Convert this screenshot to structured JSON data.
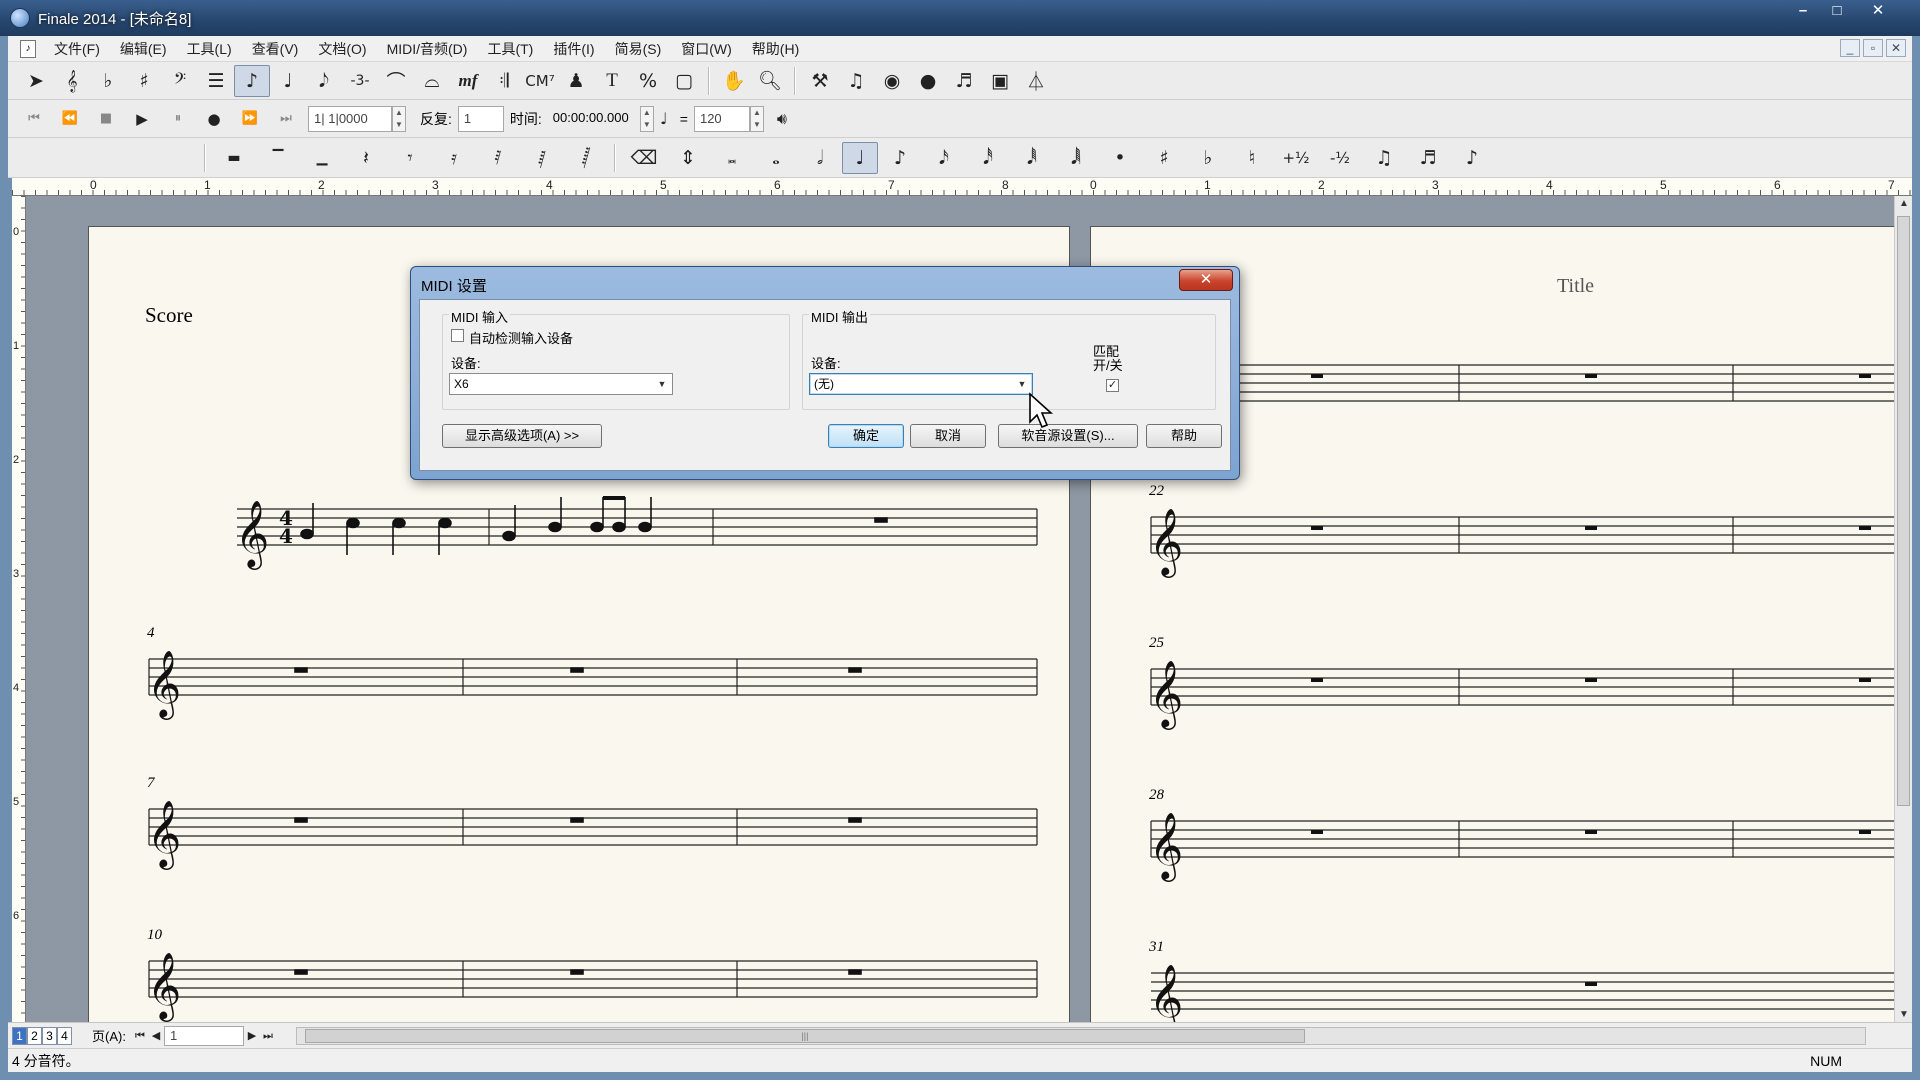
{
  "window": {
    "title": "Finale 2014 - [未命名8]",
    "controls": [
      "–",
      "□",
      "✕"
    ]
  },
  "menubar": {
    "items": [
      "文件(F)",
      "编辑(E)",
      "工具(L)",
      "查看(V)",
      "文档(O)",
      "MIDI/音频(D)",
      "工具(T)",
      "插件(I)",
      "简易(S)",
      "窗口(W)",
      "帮助(H)"
    ]
  },
  "toolbar_main": {
    "chord_symbol": "CM⁷",
    "text_tool": "T",
    "percent_tool": "%",
    "expression_tool": "mf"
  },
  "playback": {
    "position": "1| 1|0000",
    "repeat_label": "反复:",
    "repeat_value": "1",
    "time_label": "时间:",
    "time_value": "00:00:00.000",
    "equals": "=",
    "tempo": "120"
  },
  "simple_entry": {
    "plus_half": "+½",
    "minus_half": "-½"
  },
  "ruler": {
    "top_numbers": [
      "0",
      "1",
      "2",
      "3",
      "4",
      "5",
      "6",
      "7",
      "8",
      "0",
      "1",
      "2",
      "3",
      "4",
      "5",
      "6",
      "7"
    ],
    "left_numbers": [
      "0",
      "1",
      "2",
      "3",
      "4",
      "5",
      "6"
    ]
  },
  "score": {
    "left_page_label": "Score",
    "right_page_title": "Title",
    "measure_numbers_left": [
      "4",
      "7",
      "10"
    ],
    "measure_numbers_right": [
      "22",
      "25",
      "28",
      "31"
    ]
  },
  "dialog": {
    "title": "MIDI 设置",
    "close": "✕",
    "input_group": "MIDI 输入",
    "auto_detect_label": "自动检测输入设备",
    "auto_detect_checked": false,
    "input_device_label": "设备:",
    "input_device_value": "X6",
    "output_group": "MIDI 输出",
    "output_device_label": "设备:",
    "output_device_value": "(无)",
    "match_label_1": "匹配",
    "match_label_2": "开/关",
    "match_checked": true,
    "advanced_button": "显示高级选项(A) >>",
    "ok_button": "确定",
    "cancel_button": "取消",
    "soundfont_button": "软音源设置(S)...",
    "help_button": "帮助"
  },
  "bottom": {
    "page_tabs": [
      "1",
      "2",
      "3",
      "4"
    ],
    "page_label": "页(A):",
    "page_value": "1",
    "scroll_grip": "|||"
  },
  "status": {
    "text": "4 分音符。",
    "num": "NUM"
  }
}
